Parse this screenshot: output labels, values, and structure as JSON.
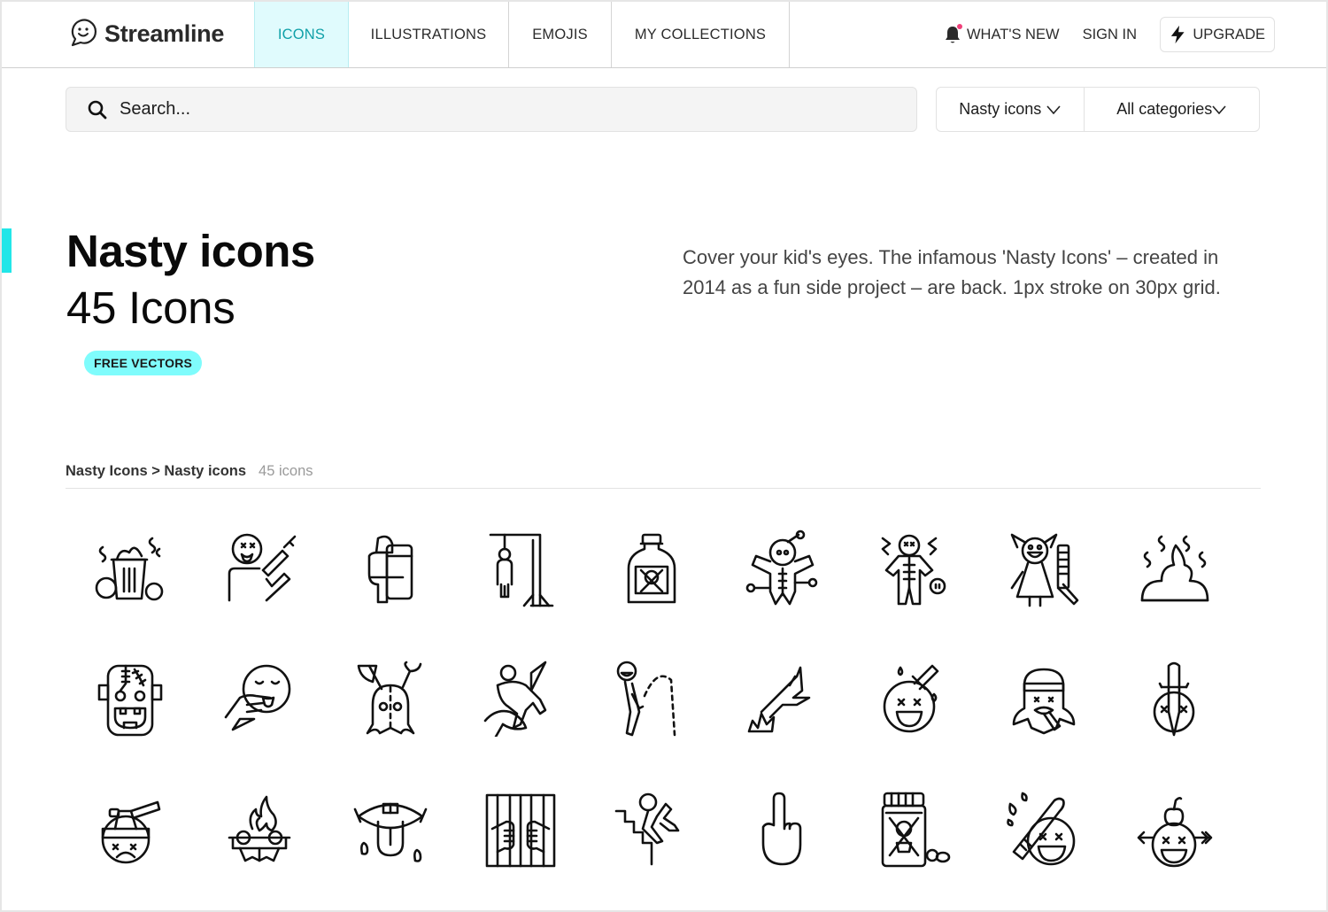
{
  "brand": {
    "name": "Streamline",
    "accent": "#0fa0a8",
    "accent_bg": "#e0fbfd",
    "highlight": "#22e6e8",
    "badge_bg": "#7ffcfc",
    "notification_dot": "#f0407a"
  },
  "nav": {
    "items": [
      {
        "label": "ICONS",
        "active": true
      },
      {
        "label": "ILLUSTRATIONS",
        "active": false
      },
      {
        "label": "EMOJIS",
        "active": false
      },
      {
        "label": "MY COLLECTIONS",
        "active": false
      }
    ],
    "whats_new": "WHAT'S NEW",
    "sign_in": "SIGN IN",
    "upgrade": "UPGRADE"
  },
  "search": {
    "placeholder": "Search...",
    "value": ""
  },
  "filters": {
    "set": "Nasty icons",
    "category": "All categories"
  },
  "hero": {
    "title": "Nasty icons",
    "count": "45 Icons",
    "badge": "FREE VECTORS",
    "description": "Cover your kid's eyes. The infamous 'Nasty Icons' – created in 2014 as a fun side project – are back. 1px stroke on 30px grid."
  },
  "breadcrumb": {
    "path": "Nasty Icons > Nasty icons",
    "count": "45 icons"
  },
  "icons": [
    {
      "name": "trash-smell-icon"
    },
    {
      "name": "drug-syringe-icon"
    },
    {
      "name": "riot-police-icon"
    },
    {
      "name": "hanging-man-icon"
    },
    {
      "name": "poison-bottle-icon"
    },
    {
      "name": "voodoo-doll-icon"
    },
    {
      "name": "electrocuted-icon"
    },
    {
      "name": "girl-chainsaw-icon"
    },
    {
      "name": "poop-icon"
    },
    {
      "name": "frankenstein-icon"
    },
    {
      "name": "finger-throat-icon"
    },
    {
      "name": "hooded-killer-icon"
    },
    {
      "name": "doll-stabbed-icon"
    },
    {
      "name": "peeing-man-icon"
    },
    {
      "name": "tree-fire-icon"
    },
    {
      "name": "knife-face-icon"
    },
    {
      "name": "hippie-smoking-icon"
    },
    {
      "name": "sword-head-icon"
    },
    {
      "name": "axe-head-icon"
    },
    {
      "name": "barbecue-fire-icon"
    },
    {
      "name": "lips-tongue-icon"
    },
    {
      "name": "prison-bars-icon"
    },
    {
      "name": "falling-stairs-icon"
    },
    {
      "name": "middle-finger-icon"
    },
    {
      "name": "poison-pills-icon"
    },
    {
      "name": "bat-hit-face-icon"
    },
    {
      "name": "apple-arrow-icon"
    }
  ]
}
